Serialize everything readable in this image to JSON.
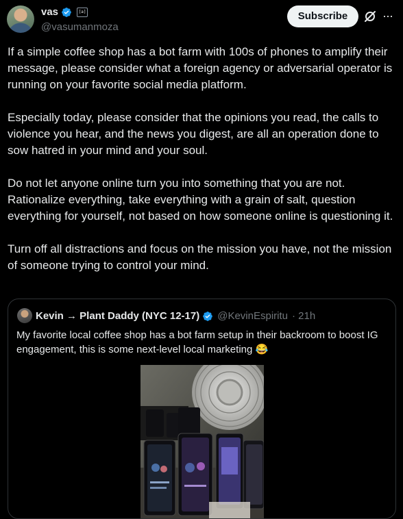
{
  "author": {
    "display_name": "vas",
    "handle": "@vasumanmoza",
    "affiliation_badge": "[a]"
  },
  "actions": {
    "subscribe_label": "Subscribe",
    "more_label": "···",
    "grok_icon": "grok-slash-circle-icon"
  },
  "post": {
    "paragraphs": [
      "If a simple coffee shop has a bot farm with 100s of phones to amplify their message, please consider what a foreign agency or adversarial operator is running on your favorite social media platform.",
      "Especially today, please consider that the opinions you read, the calls to violence you hear, and the news you digest, are all an operation done to sow hatred in your mind and your soul.",
      "Do not let anyone online turn you into something that you are not. Rationalize everything, take everything with a grain of salt, question everything for yourself, not based on how someone online is questioning it.",
      "Turn off all distractions and focus on the mission you have, not the mission of someone trying to control your mind."
    ]
  },
  "quote": {
    "display_name": "Kevin → Plant Daddy (NYC 12-17)",
    "handle": "@KevinEspiritu",
    "time": "· 21h",
    "text": "My favorite local coffee shop has a bot farm setup in their backroom to boost IG engagement, this is some next-level local marketing 😂",
    "media_alt": "phones-on-table-with-fan-photo"
  },
  "colors": {
    "background": "#000000",
    "text": "#e7e9ea",
    "secondary": "#71767b",
    "verified": "#1d9bf0",
    "border": "#2f3336"
  }
}
